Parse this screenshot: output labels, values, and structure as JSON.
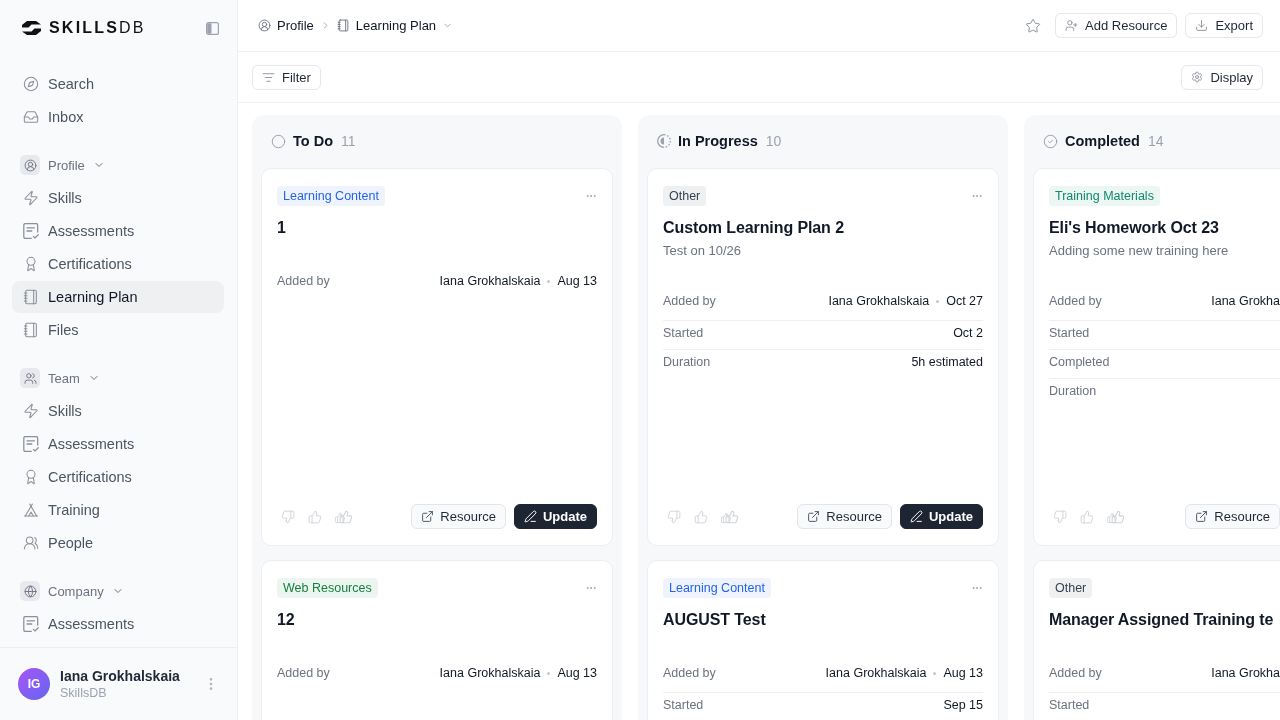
{
  "sidebar": {
    "logo": "**SKILLS**DB",
    "top_items": [
      {
        "label": "Search",
        "selected": false
      },
      {
        "label": "Inbox",
        "selected": false
      }
    ],
    "sections": [
      {
        "label": "Profile",
        "expanded": true,
        "items": [
          {
            "label": "Skills",
            "selected": false
          },
          {
            "label": "Assessments",
            "selected": false
          },
          {
            "label": "Certifications",
            "selected": false
          },
          {
            "label": "Learning Plan",
            "selected": true
          },
          {
            "label": "Files",
            "selected": false
          }
        ]
      },
      {
        "label": "Team",
        "expanded": true,
        "items": [
          {
            "label": "Skills",
            "selected": false
          },
          {
            "label": "Assessments",
            "selected": false
          },
          {
            "label": "Certifications",
            "selected": false
          },
          {
            "label": "Training",
            "selected": false
          },
          {
            "label": "People",
            "selected": false
          }
        ]
      },
      {
        "label": "Company",
        "expanded": true,
        "items": [
          {
            "label": "Assessments",
            "selected": false
          }
        ]
      }
    ],
    "user": {
      "initials": "IG",
      "name": "Iana Grokhalskaia",
      "org": "SkillsDB"
    }
  },
  "header": {
    "breadcrumb": [
      {
        "label": "Profile"
      },
      {
        "label": "Learning Plan"
      }
    ],
    "actions": [
      {
        "label": "Add Resource"
      },
      {
        "label": "Export"
      }
    ]
  },
  "toolbar": {
    "filter": "Filter",
    "display": "Display"
  },
  "columns": [
    {
      "title": "To Do",
      "count": "11",
      "kind": "todo",
      "cards": [
        {
          "tag": {
            "label": "Learning Content",
            "color": "#2563eb"
          },
          "title": "1",
          "fields": [
            {
              "label": "Added by",
              "value": "Iana Grokhalskaia",
              "date": "Aug 13"
            }
          ],
          "buttons": [
            {
              "label": "Resource",
              "kind": "secondary"
            },
            {
              "label": "Update",
              "kind": "primary"
            }
          ]
        },
        {
          "tag": {
            "label": "Web Resources",
            "color": "#15803d"
          },
          "title": "12",
          "fields": [
            {
              "label": "Added by",
              "value": "Iana Grokhalskaia",
              "date": "Aug 13"
            }
          ]
        }
      ]
    },
    {
      "title": "In Progress",
      "count": "10",
      "kind": "in_progress",
      "cards": [
        {
          "tag": {
            "label": "Other",
            "color": "#374151"
          },
          "title": "Custom Learning Plan 2",
          "subtitle": "Test on 10/26",
          "fields": [
            {
              "label": "Added by",
              "value": "Iana Grokhalskaia",
              "date": "Oct 27"
            },
            {
              "label": "Started",
              "value": "Oct 2"
            },
            {
              "label": "Duration",
              "value": "5h estimated"
            }
          ],
          "buttons": [
            {
              "label": "Resource",
              "kind": "secondary"
            },
            {
              "label": "Update",
              "kind": "primary"
            }
          ]
        },
        {
          "tag": {
            "label": "Learning Content",
            "color": "#2563eb"
          },
          "title": "AUGUST Test",
          "fields": [
            {
              "label": "Added by",
              "value": "Iana Grokhalskaia",
              "date": "Aug 13"
            },
            {
              "label": "Started",
              "value": "Sep 15"
            }
          ]
        }
      ]
    },
    {
      "title": "Completed",
      "count": "14",
      "kind": "completed",
      "cards": [
        {
          "tag": {
            "label": "Training Materials",
            "color": "#0f8a6a"
          },
          "title": "Eli's Homework Oct 23",
          "subtitle": "Adding some new training here",
          "fields": [
            {
              "label": "Added by",
              "value": "Iana Grokha"
            },
            {
              "label": "Started"
            },
            {
              "label": "Completed"
            },
            {
              "label": "Duration"
            }
          ],
          "buttons": [
            {
              "label": "Resource",
              "kind": "secondary"
            }
          ]
        },
        {
          "tag": {
            "label": "Other",
            "color": "#374151"
          },
          "title": "Manager Assigned Training te",
          "fields": [
            {
              "label": "Added by",
              "value": "Iana Grokha"
            },
            {
              "label": "Started"
            }
          ]
        }
      ]
    }
  ]
}
